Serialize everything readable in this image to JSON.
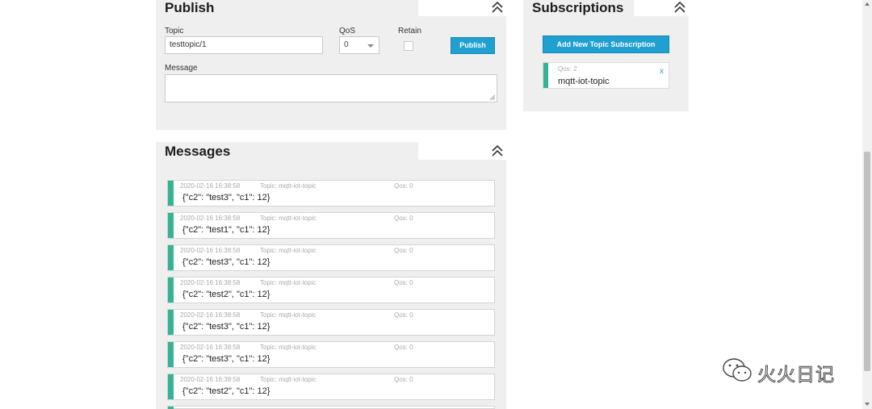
{
  "publish": {
    "title": "Publish",
    "topic_label": "Topic",
    "topic_value": "testtopic/1",
    "qos_label": "QoS",
    "qos_value": "0",
    "retain_label": "Retain",
    "publish_button": "Publish",
    "message_label": "Message",
    "message_value": ""
  },
  "subscriptions": {
    "title": "Subscriptions",
    "add_button": "Add New Topic Subscription",
    "items": [
      {
        "qos": "Qos: 2",
        "topic": "mqtt-iot-topic",
        "close": "x",
        "color": "#36b394"
      }
    ]
  },
  "messages": {
    "title": "Messages",
    "items": [
      {
        "date": "2020-02-16 16:38:58",
        "topic": "Topic: mqtt-iot-topic",
        "qos": "Qos: 0",
        "payload": "{\"c2\": \"test3\", \"c1\": 12}"
      },
      {
        "date": "2020-02-16 16:38:58",
        "topic": "Topic: mqtt-iot-topic",
        "qos": "Qos: 0",
        "payload": "{\"c2\": \"test1\", \"c1\": 12}"
      },
      {
        "date": "2020-02-16 16:38:58",
        "topic": "Topic: mqtt-iot-topic",
        "qos": "Qos: 0",
        "payload": "{\"c2\": \"test3\", \"c1\": 12}"
      },
      {
        "date": "2020-02-16 16:38:58",
        "topic": "Topic: mqtt-iot-topic",
        "qos": "Qos: 0",
        "payload": "{\"c2\": \"test2\", \"c1\": 12}"
      },
      {
        "date": "2020-02-16 16:38:58",
        "topic": "Topic: mqtt-iot-topic",
        "qos": "Qos: 0",
        "payload": "{\"c2\": \"test3\", \"c1\": 12}"
      },
      {
        "date": "2020-02-16 16:38:58",
        "topic": "Topic: mqtt-iot-topic",
        "qos": "Qos: 0",
        "payload": "{\"c2\": \"test3\", \"c1\": 12}"
      },
      {
        "date": "2020-02-16 16:38:58",
        "topic": "Topic: mqtt-iot-topic",
        "qos": "Qos: 0",
        "payload": "{\"c2\": \"test2\", \"c1\": 12}"
      }
    ]
  },
  "watermark": {
    "text": "火火日记",
    "icon": "wechat-icon"
  },
  "colors": {
    "accent_blue": "#1fa0d0",
    "message_bar": "#36b394",
    "panel_bg": "#efefef"
  },
  "icons": {
    "collapse": "double-chevron-up-icon",
    "close": "close-icon"
  }
}
